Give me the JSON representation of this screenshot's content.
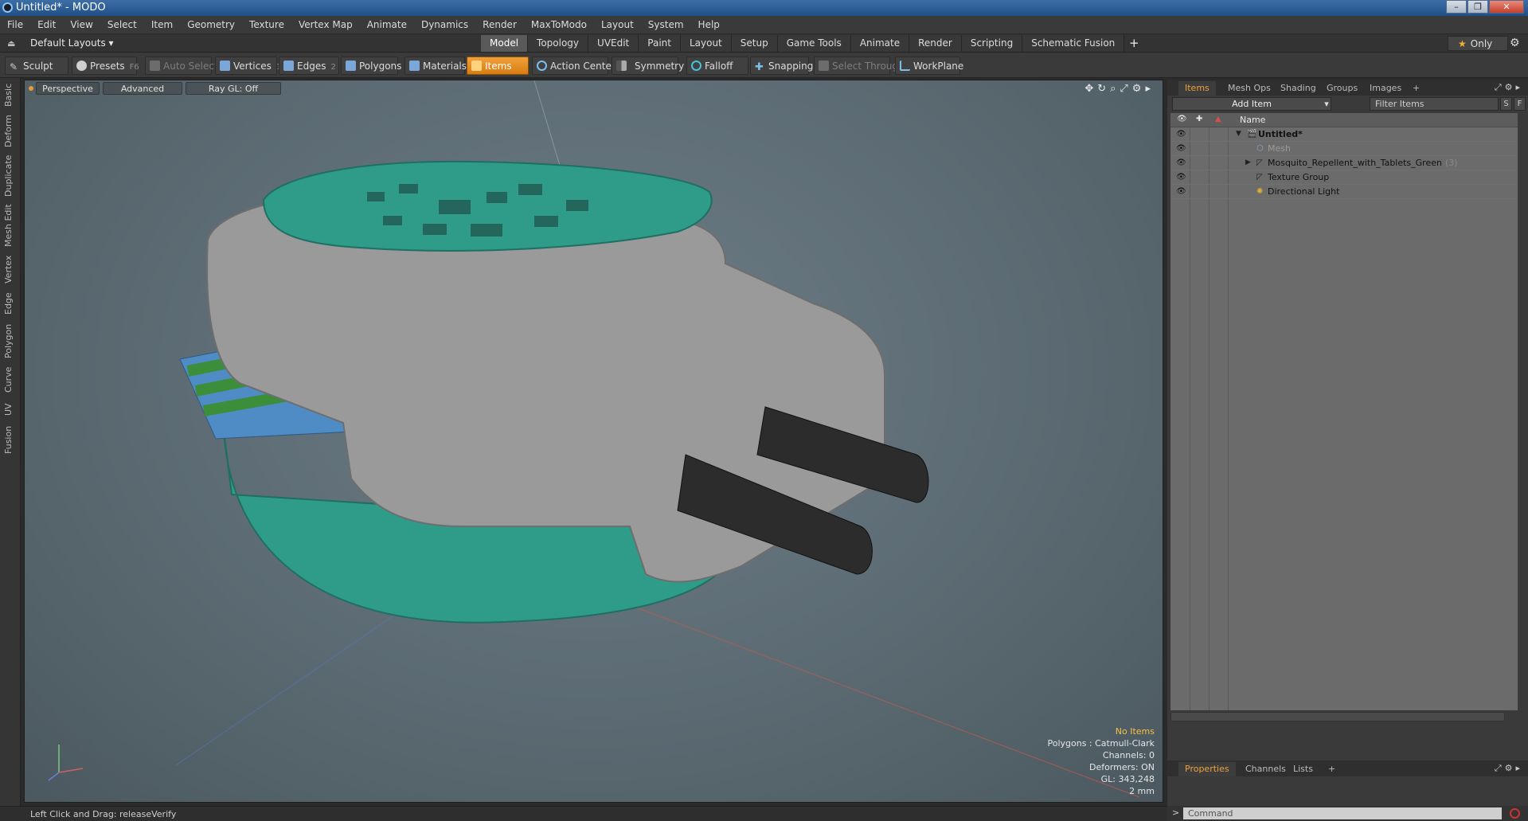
{
  "window": {
    "title": "Untitled* - MODO",
    "min": "–",
    "max": "❐",
    "close": "✕"
  },
  "menu": [
    "File",
    "Edit",
    "View",
    "Select",
    "Item",
    "Geometry",
    "Texture",
    "Vertex Map",
    "Animate",
    "Dynamics",
    "Render",
    "MaxToModo",
    "Layout",
    "System",
    "Help"
  ],
  "layout": {
    "selector": "Default Layouts ▾",
    "only": "Only",
    "tabs": [
      "Model",
      "Topology",
      "UVEdit",
      "Paint",
      "Layout",
      "Setup",
      "Game Tools",
      "Animate",
      "Render",
      "Scripting",
      "Schematic Fusion"
    ],
    "add": "+"
  },
  "toolbar": {
    "sculpt": "Sculpt",
    "presets": "Presets",
    "presets_key": "F6",
    "auto_select": "Auto Select",
    "vertices": "Vertices",
    "vertices_key": "1",
    "edges": "Edges",
    "edges_key": "2",
    "polygons": "Polygons",
    "materials": "Materials",
    "items": "Items",
    "action_center": "Action Center",
    "symmetry": "Symmetry",
    "falloff": "Falloff",
    "snapping": "Snapping",
    "select_through": "Select Through",
    "workplane": "WorkPlane"
  },
  "left_tabs": [
    "Basic",
    "Deform",
    "Duplicate",
    "Mesh Edit",
    "Vertex",
    "Edge",
    "Polygon",
    "Curve",
    "UV",
    "Fusion"
  ],
  "viewport": {
    "perspective": "Perspective",
    "advanced": "Advanced",
    "raygl": "Ray GL: Off",
    "stats": {
      "selection": "No Items",
      "polygons": "Polygons : Catmull-Clark",
      "channels": "Channels: 0",
      "deformers": "Deformers: ON",
      "gl": "GL: 343,248",
      "unit": "2 mm"
    }
  },
  "panel": {
    "tabs": [
      "Items",
      "Mesh Ops",
      "Shading",
      "Groups",
      "Images"
    ],
    "add_item": "Add Item",
    "filter": "Filter Items",
    "s": "S",
    "f": "F",
    "col_name": "Name",
    "rows": [
      {
        "label": "Untitled*",
        "count": ""
      },
      {
        "label": "Mesh",
        "count": ""
      },
      {
        "label": "Mosquito_Repellent_with_Tablets_Green",
        "count": "(3)"
      },
      {
        "label": "Texture Group",
        "count": ""
      },
      {
        "label": "Directional Light",
        "count": ""
      }
    ],
    "bottom_tabs": [
      "Properties",
      "Channels",
      "Lists"
    ]
  },
  "command": {
    "placeholder": "Command",
    "prompt": ">"
  },
  "status": {
    "text": "Left Click and Drag:   releaseVerify"
  },
  "colors": {
    "accent": "#f0a13a",
    "teal": "#2f9b89",
    "gray_body": "#9a9a9a"
  }
}
